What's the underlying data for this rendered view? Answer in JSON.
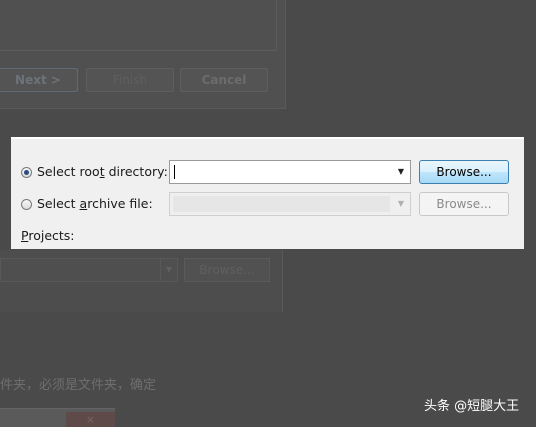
{
  "background": {
    "wizard_buttons": {
      "next": "Next >",
      "finish": "Finish",
      "cancel": "Cancel"
    },
    "browse_label": "Browse...",
    "caption": "件夹，必须是文件夹，确定"
  },
  "dialog": {
    "root_option": {
      "label_before": "Select roo",
      "label_mnemonic": "t",
      "label_after": " directory:",
      "selected": true,
      "value": "",
      "browse_label": "Browse..."
    },
    "archive_option": {
      "label_before": "Select ",
      "label_mnemonic": "a",
      "label_after": "rchive file:",
      "selected": false,
      "value": "",
      "browse_label": "Browse..."
    },
    "projects_label_mnemonic": "P",
    "projects_label_rest": "rojects:"
  },
  "watermark": "头条 @短腿大王",
  "colors": {
    "overlay": "#4a4a4a",
    "panel": "#f0f0f0",
    "active_button_border": "#3c7fb1"
  }
}
